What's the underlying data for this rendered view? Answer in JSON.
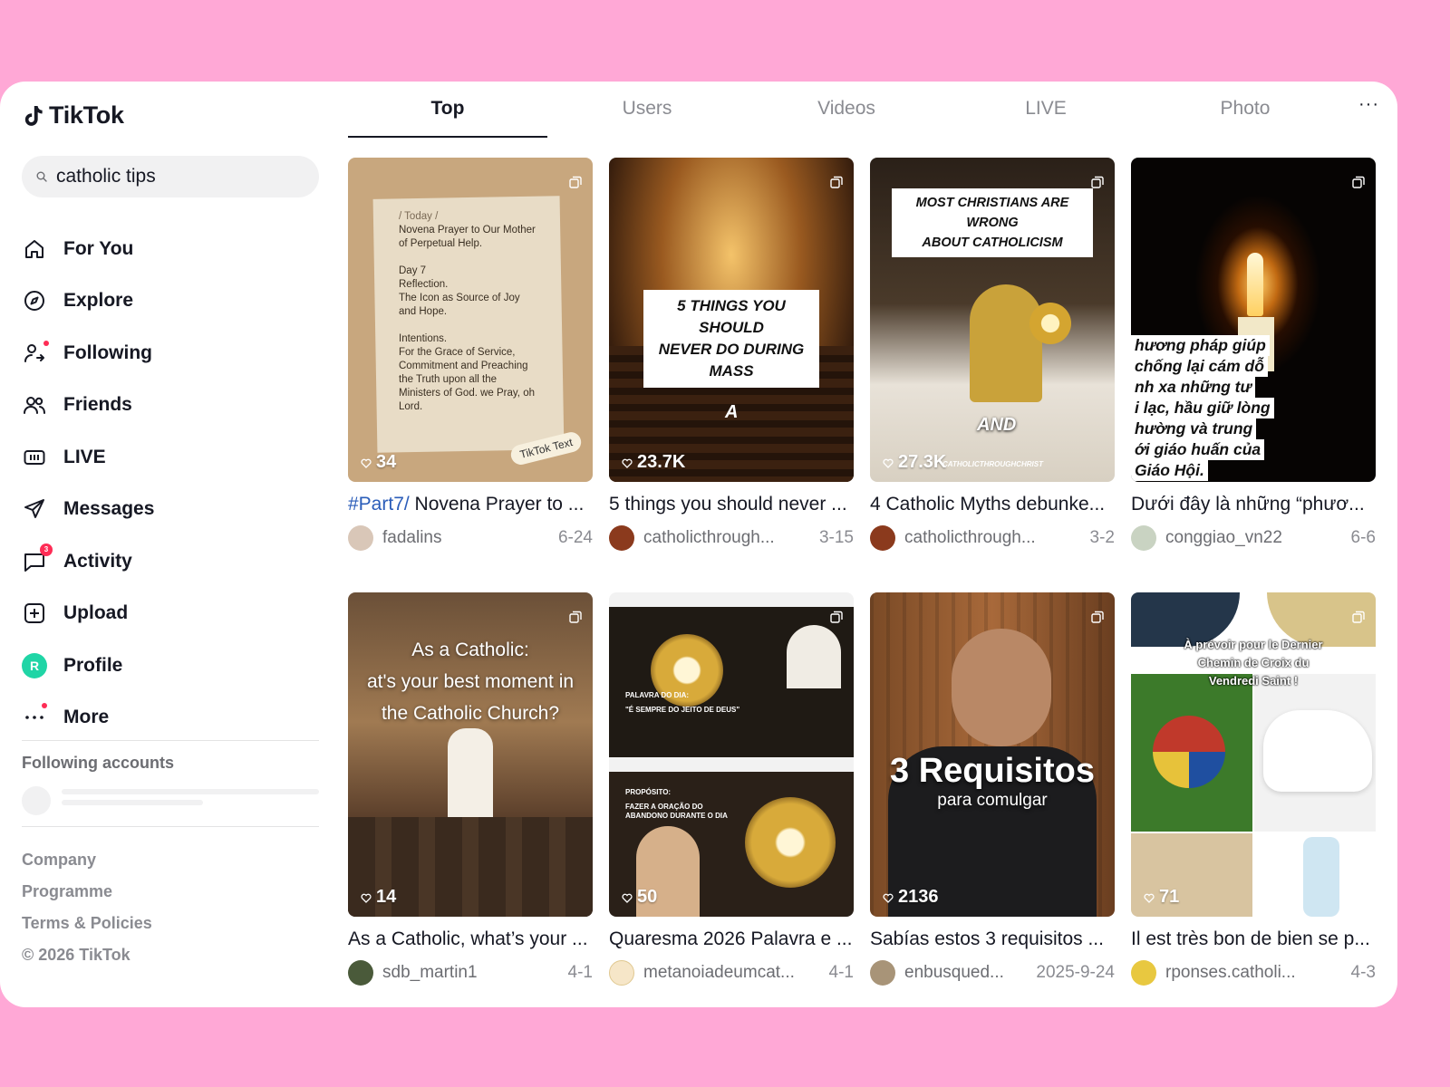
{
  "app": {
    "name": "TikTok"
  },
  "search": {
    "value": "catholic tips"
  },
  "nav": [
    {
      "label": "For You",
      "icon": "home-icon"
    },
    {
      "label": "Explore",
      "icon": "compass-icon"
    },
    {
      "label": "Following",
      "icon": "user-follow-icon",
      "dot": true
    },
    {
      "label": "Friends",
      "icon": "friends-icon"
    },
    {
      "label": "LIVE",
      "icon": "live-icon"
    },
    {
      "label": "Messages",
      "icon": "send-icon"
    },
    {
      "label": "Activity",
      "icon": "message-icon",
      "badge": "3"
    },
    {
      "label": "Upload",
      "icon": "upload-icon"
    },
    {
      "label": "Profile",
      "icon": "avatar",
      "initial": "R"
    },
    {
      "label": "More",
      "icon": "more-icon",
      "dot": true
    }
  ],
  "following": {
    "title": "Following accounts"
  },
  "footer": [
    "Company",
    "Programme",
    "Terms & Policies",
    "© 2026 TikTok"
  ],
  "tabs": [
    "Top",
    "Users",
    "Videos",
    "LIVE",
    "Photo"
  ],
  "tabs_more": "···",
  "colors": {
    "accent": "#fe2c55",
    "hashtag": "#2b5db9",
    "page_bg": "#ffa8d6"
  },
  "videos": [
    {
      "tag": "#Part7/",
      "title": " Novena Prayer to ...",
      "likes": "34",
      "user": "fadalins",
      "date": "6-24",
      "note": [
        "/ Today /",
        "Novena Prayer to Our Mother",
        "of Perpetual Help.",
        "",
        "Day 7",
        "Reflection.",
        "The Icon as Source of Joy",
        "and Hope.",
        "",
        "Intentions.",
        "For the Grace of Service,",
        "Commitment and Preaching",
        "the Truth upon all the",
        "Ministers of God. we Pray, oh",
        "Lord."
      ],
      "sticker": "TikTok Text"
    },
    {
      "tag": "",
      "title": "5 things you should never ...",
      "likes": "23.7K",
      "user": "catholicthrough...",
      "date": "3-15",
      "overlay": [
        "5 THINGS YOU SHOULD",
        "NEVER DO DURING MASS"
      ],
      "overlay2": "A"
    },
    {
      "tag": "",
      "title": "4 Catholic Myths debunke...",
      "likes": "27.3K",
      "user": "catholicthrough...",
      "date": "3-2",
      "overlay": [
        "MOST CHRISTIANS ARE WRONG",
        "ABOUT CATHOLICISM"
      ],
      "overlay2": "AND",
      "watermark": "CATHOLICTHROUGHCHRIST"
    },
    {
      "tag": "",
      "title": "Dưới đây là những “phươ...",
      "likes": "",
      "user": "conggiao_vn22",
      "date": "6-6",
      "overlay": [
        "hương pháp giúp",
        "chống lại cám dỗ",
        "nh xa những tư",
        "i lạc, hầu giữ lòng",
        "hường và trung",
        "ới giáo huấn của",
        "Giáo Hội."
      ]
    },
    {
      "tag": "",
      "title": "As a Catholic, what’s your ...",
      "likes": "14",
      "user": "sdb_martin1",
      "date": "4-1",
      "overlay": [
        "As a Catholic:",
        "at's your best moment in",
        "the Catholic Church?"
      ]
    },
    {
      "tag": "",
      "title": "Quaresma 2026 Palavra e ...",
      "likes": "50",
      "user": "metanoiadeumcat...",
      "date": "4-1",
      "overlay": [
        "PALAVRA DO DIA:",
        "\"É SEMPRE DO JEITO DE DEUS\"",
        "PROPÓSITO:",
        "FAZER A ORAÇÃO DO",
        "ABANDONO DURANTE O DIA"
      ]
    },
    {
      "tag": "",
      "title": "Sabías estos 3 requisitos ...",
      "likes": "2136",
      "user": "enbusqued...",
      "date": "2025-9-24",
      "overlay": [
        "3 Requisitos",
        "para comulgar"
      ]
    },
    {
      "tag": "",
      "title": "Il est très bon de bien se p...",
      "likes": "71",
      "user": "rponses.catholi...",
      "date": "4-3",
      "overlay": [
        "À prévoir pour le Dernier",
        "Chemin de Croix du",
        "Vendredi Saint !"
      ]
    }
  ]
}
